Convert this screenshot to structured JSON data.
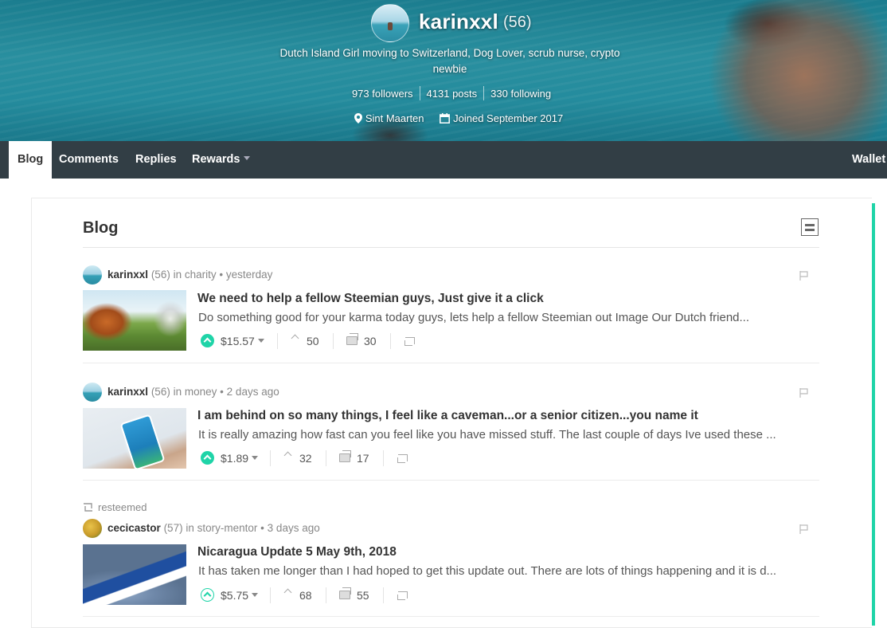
{
  "profile": {
    "name": "karinxxl",
    "reputation": "(56)",
    "about": "Dutch Island Girl moving to Switzerland, Dog Lover, scrub nurse, crypto newbie",
    "followers": "973 followers",
    "posts": "4131 posts",
    "following": "330 following",
    "location": "Sint Maarten",
    "joined": "Joined September 2017"
  },
  "tabs": [
    {
      "label": "Blog",
      "active": true
    },
    {
      "label": "Comments",
      "active": false
    },
    {
      "label": "Replies",
      "active": false
    },
    {
      "label": "Rewards",
      "active": false,
      "has_dropdown": true
    }
  ],
  "wallet_label": "Wallet",
  "blog": {
    "heading": "Blog",
    "posts": [
      {
        "resteemed": false,
        "author": "karinxxl",
        "reputation": "(56)",
        "category_prefix": "in",
        "category": "charity",
        "time": "yesterday",
        "title": "We need to help a fellow Steemian guys, Just give it a click",
        "body": "Do something good for your karma today guys, lets help a fellow Steemian out Image Our Dutch friend...",
        "payout": "$15.57",
        "votes": "50",
        "comments": "30",
        "voted": true
      },
      {
        "resteemed": false,
        "author": "karinxxl",
        "reputation": "(56)",
        "category_prefix": "in",
        "category": "money",
        "time": "2 days ago",
        "title": "I am behind on so many things, I feel like a caveman...or a senior citizen...you name it",
        "body": "It is really amazing how fast can you feel like you have missed stuff. The last couple of days Ive used these ...",
        "payout": "$1.89",
        "votes": "32",
        "comments": "17",
        "voted": true
      },
      {
        "resteemed": true,
        "resteem_label": "resteemed",
        "author": "cecicastor",
        "reputation": "(57)",
        "category_prefix": "in",
        "category": "story-mentor",
        "time": "3 days ago",
        "title": "Nicaragua Update 5 May 9th, 2018",
        "body": "It has taken me longer than I had hoped to get this update out. There are lots of things happening and it is d...",
        "payout": "$5.75",
        "votes": "68",
        "comments": "55",
        "voted": false
      }
    ]
  },
  "colors": {
    "accent": "#1fd4a8",
    "tabbar": "#323e45",
    "text": "#333333",
    "muted": "#888888"
  }
}
